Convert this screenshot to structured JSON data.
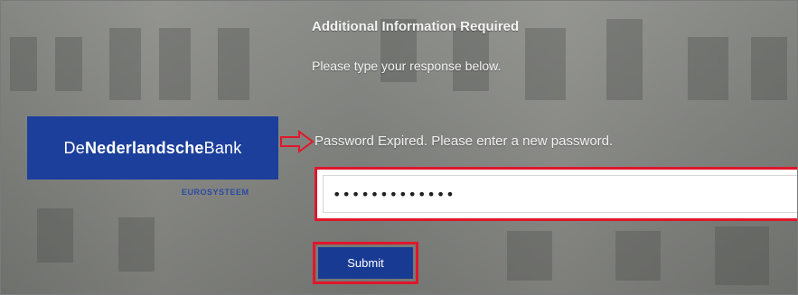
{
  "header": {
    "title": "Additional Information Required",
    "subtitle": "Please type your response below."
  },
  "logo": {
    "text_de": "De",
    "text_nederlandsche": "Nederlandsche",
    "text_bank": "Bank",
    "subtext": "EUROSYSTEEM",
    "brand_color": "#1c3f9b"
  },
  "form": {
    "message": "Password Expired. Please enter a new password.",
    "password_value": "•••••••••••••",
    "submit_label": "Submit"
  },
  "colors": {
    "highlight": "#e0162b",
    "button": "#183a93"
  }
}
